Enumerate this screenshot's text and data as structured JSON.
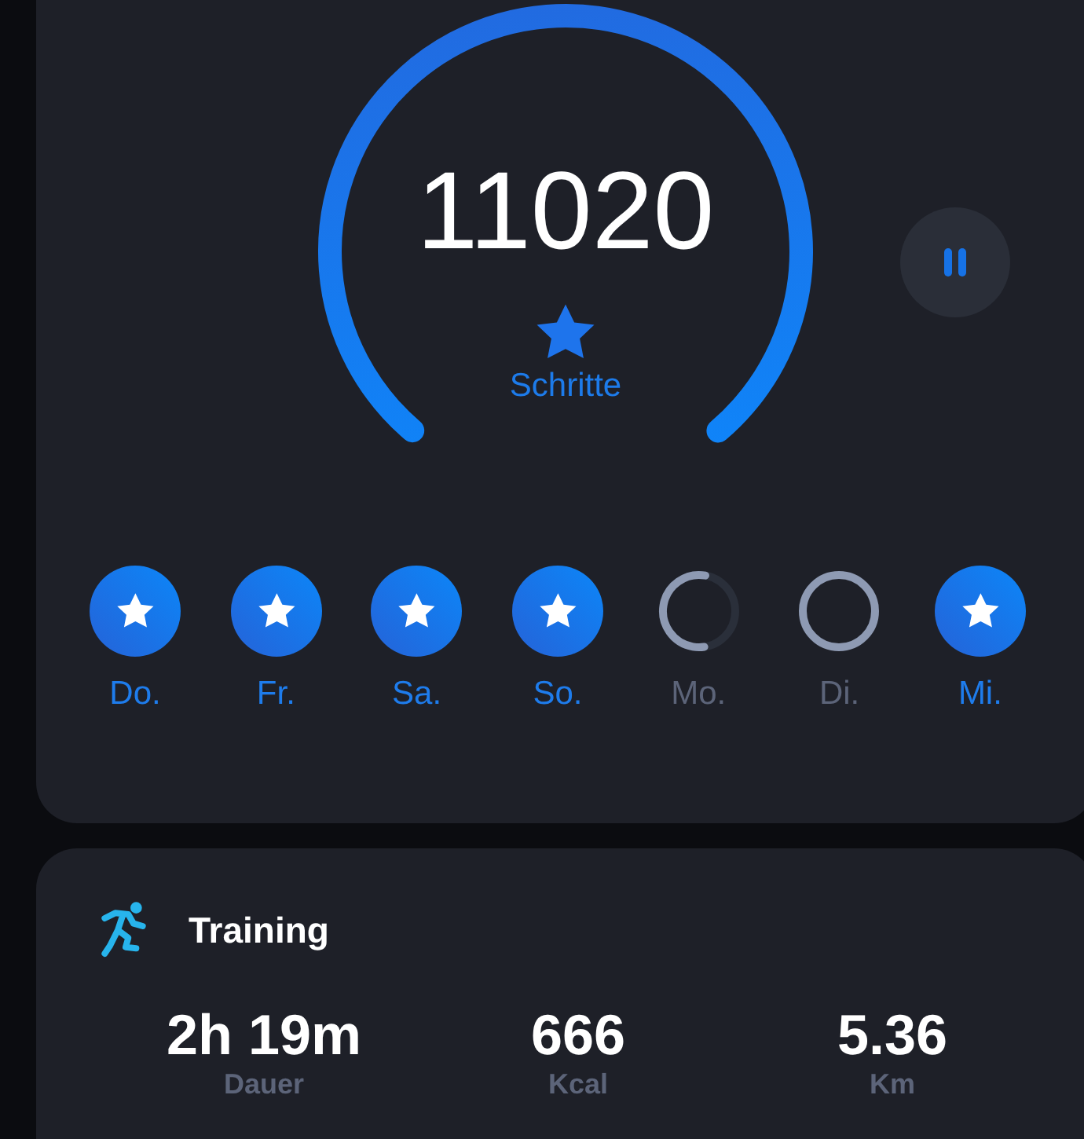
{
  "steps": {
    "value": "11020",
    "label": "Schritte"
  },
  "days": [
    {
      "label": "Do.",
      "kind": "star"
    },
    {
      "label": "Fr.",
      "kind": "star"
    },
    {
      "label": "Sa.",
      "kind": "star"
    },
    {
      "label": "So.",
      "kind": "star"
    },
    {
      "label": "Mo.",
      "kind": "partial"
    },
    {
      "label": "Di.",
      "kind": "empty"
    },
    {
      "label": "Mi.",
      "kind": "star"
    }
  ],
  "training": {
    "title": "Training",
    "stats": [
      {
        "value": "2h 19m",
        "label": "Dauer"
      },
      {
        "value": "666",
        "label": "Kcal"
      },
      {
        "value": "5.36",
        "label": "Km"
      }
    ]
  }
}
